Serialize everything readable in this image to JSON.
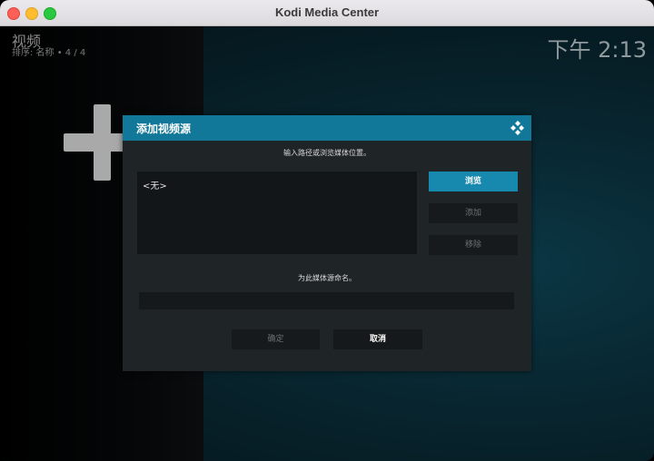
{
  "window": {
    "title": "Kodi Media Center"
  },
  "header": {
    "section_title": "视频",
    "sort_info": "排序: 名称  •  4 / 4",
    "clock": "下午 2:13"
  },
  "add_item_icon": "plus-icon",
  "dialog": {
    "title": "添加视频源",
    "logo_icon": "kodi-logo-icon",
    "path_instruction": "输入路径或浏览媒体位置。",
    "paths": [
      "<无>"
    ],
    "buttons": {
      "browse": "浏览",
      "add": "添加",
      "remove": "移除"
    },
    "name_instruction": "为此媒体源命名。",
    "name_value": "",
    "ok_label": "确定",
    "cancel_label": "取消"
  },
  "colors": {
    "accent": "#11789a",
    "button_focus": "#1789ae",
    "dialog_bg": "#1f2427"
  }
}
